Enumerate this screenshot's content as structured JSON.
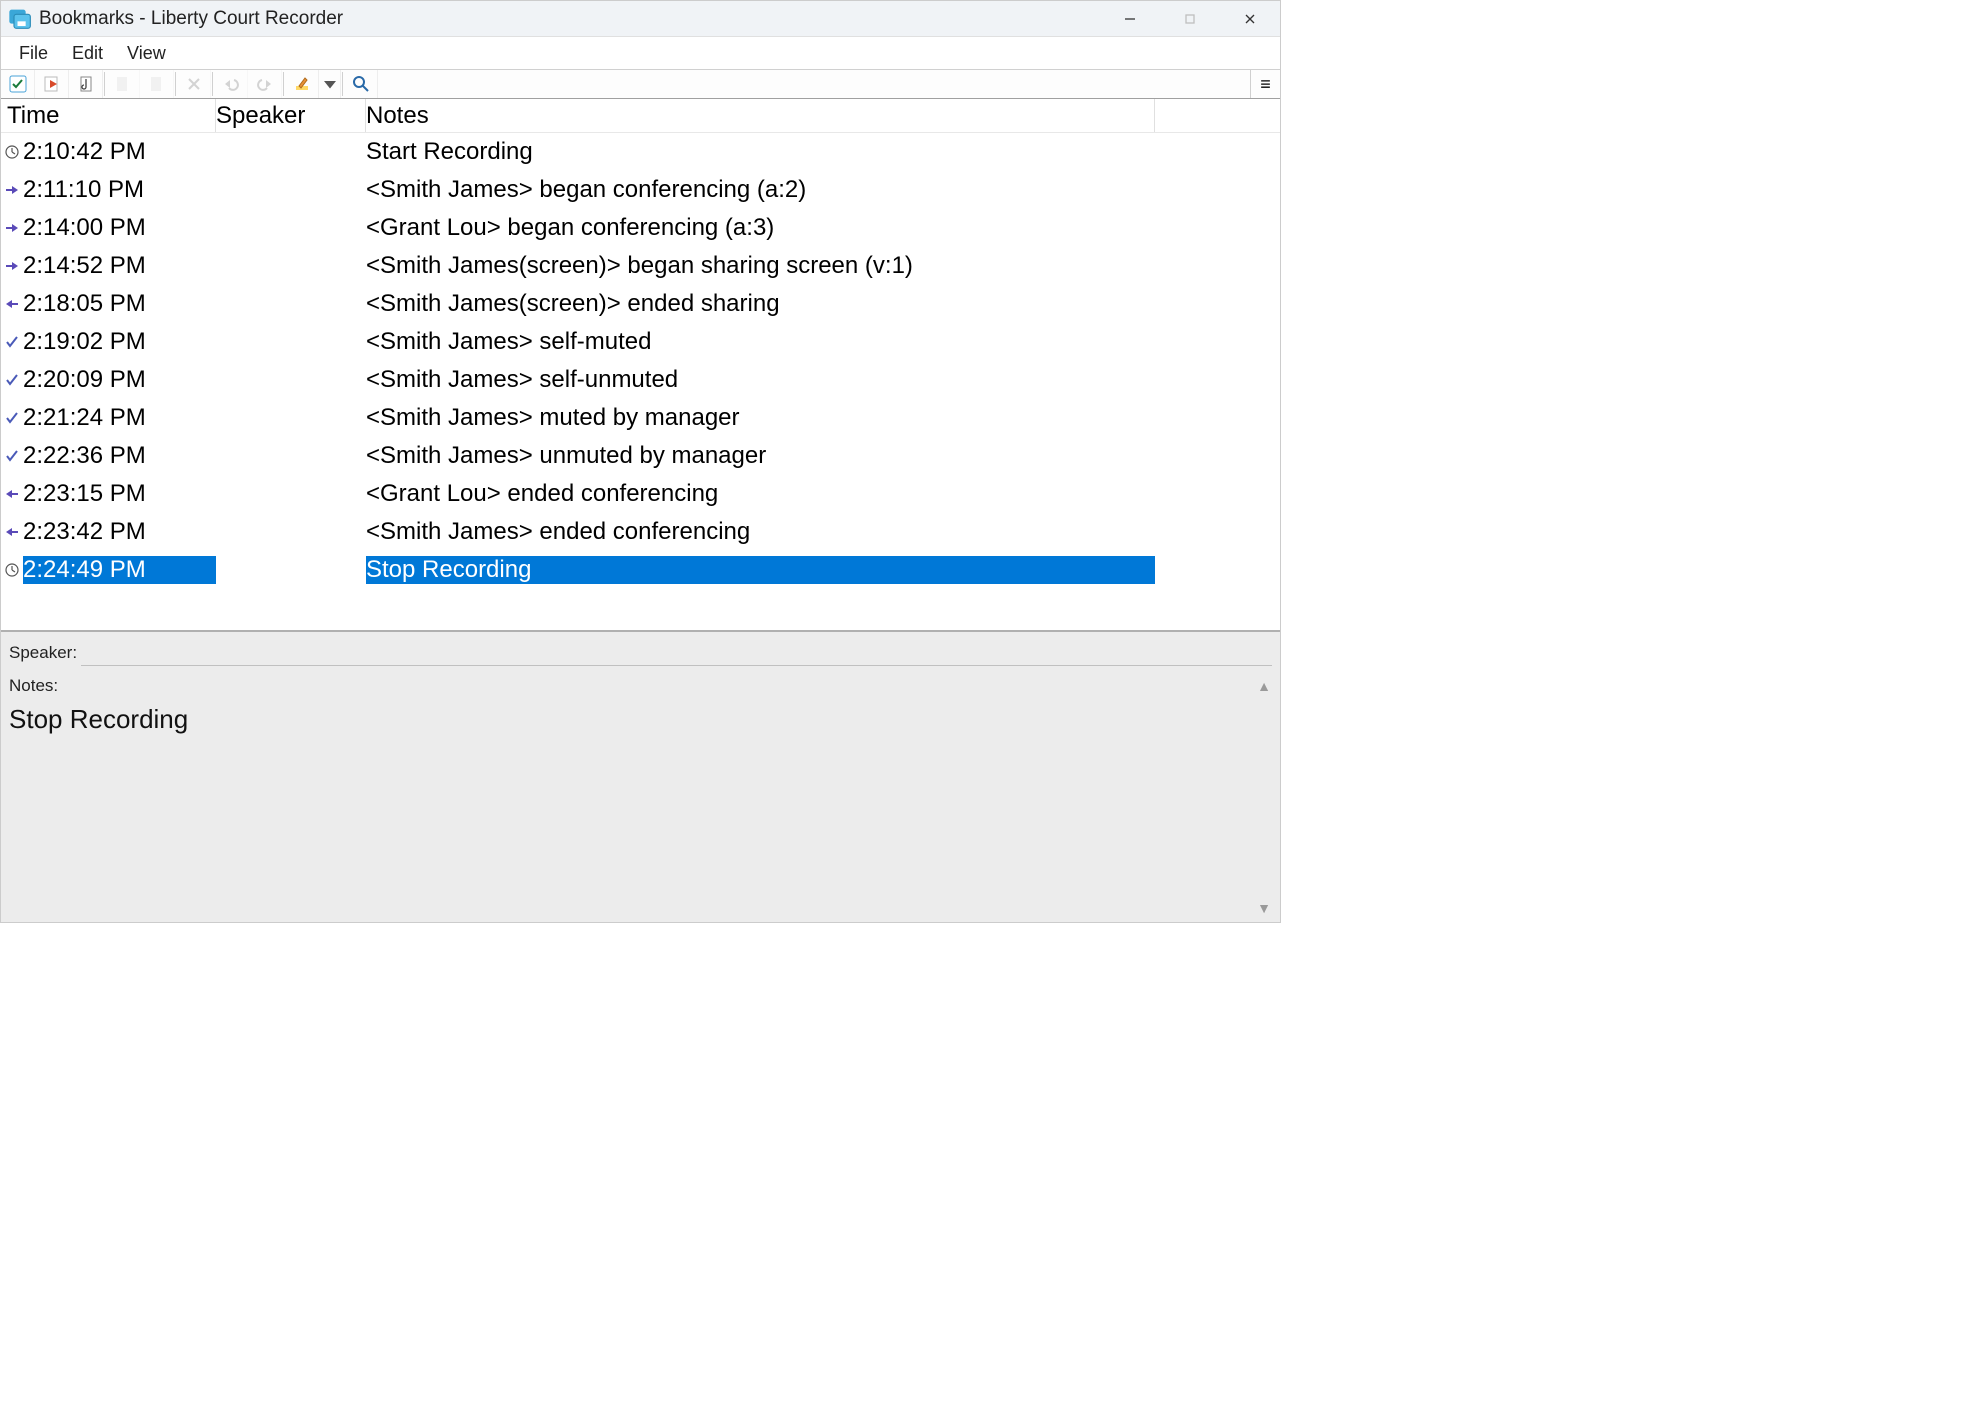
{
  "window": {
    "title": "Bookmarks - Liberty Court Recorder"
  },
  "menu": {
    "file": "File",
    "edit": "Edit",
    "view": "View"
  },
  "columns": {
    "time": "Time",
    "speaker": "Speaker",
    "notes": "Notes"
  },
  "rows": [
    {
      "icon": "clock",
      "time": "2:10:42 PM",
      "speaker": "",
      "notes": "Start Recording",
      "selected": false
    },
    {
      "icon": "join",
      "time": "2:11:10 PM",
      "speaker": "",
      "notes": "<Smith James> began conferencing (a:2)",
      "selected": false
    },
    {
      "icon": "join",
      "time": "2:14:00 PM",
      "speaker": "",
      "notes": "<Grant Lou> began conferencing (a:3)",
      "selected": false
    },
    {
      "icon": "join",
      "time": "2:14:52 PM",
      "speaker": "",
      "notes": "<Smith James(screen)> began sharing screen (v:1)",
      "selected": false
    },
    {
      "icon": "leave",
      "time": "2:18:05 PM",
      "speaker": "",
      "notes": "<Smith James(screen)> ended sharing",
      "selected": false
    },
    {
      "icon": "check",
      "time": "2:19:02 PM",
      "speaker": "",
      "notes": "<Smith James> self-muted",
      "selected": false
    },
    {
      "icon": "check",
      "time": "2:20:09 PM",
      "speaker": "",
      "notes": "<Smith James> self-unmuted",
      "selected": false
    },
    {
      "icon": "check",
      "time": "2:21:24 PM",
      "speaker": "",
      "notes": "<Smith James> muted by manager",
      "selected": false
    },
    {
      "icon": "check",
      "time": "2:22:36 PM",
      "speaker": "",
      "notes": "<Smith James> unmuted by manager",
      "selected": false
    },
    {
      "icon": "leave",
      "time": "2:23:15 PM",
      "speaker": "",
      "notes": "<Grant Lou> ended conferencing",
      "selected": false
    },
    {
      "icon": "leave",
      "time": "2:23:42 PM",
      "speaker": "",
      "notes": "<Smith James> ended conferencing",
      "selected": false
    },
    {
      "icon": "clock",
      "time": "2:24:49 PM",
      "speaker": "",
      "notes": "Stop Recording",
      "selected": true
    }
  ],
  "detail": {
    "speaker_label": "Speaker:",
    "speaker_value": "",
    "notes_label": "Notes:",
    "notes_value": "Stop Recording"
  }
}
